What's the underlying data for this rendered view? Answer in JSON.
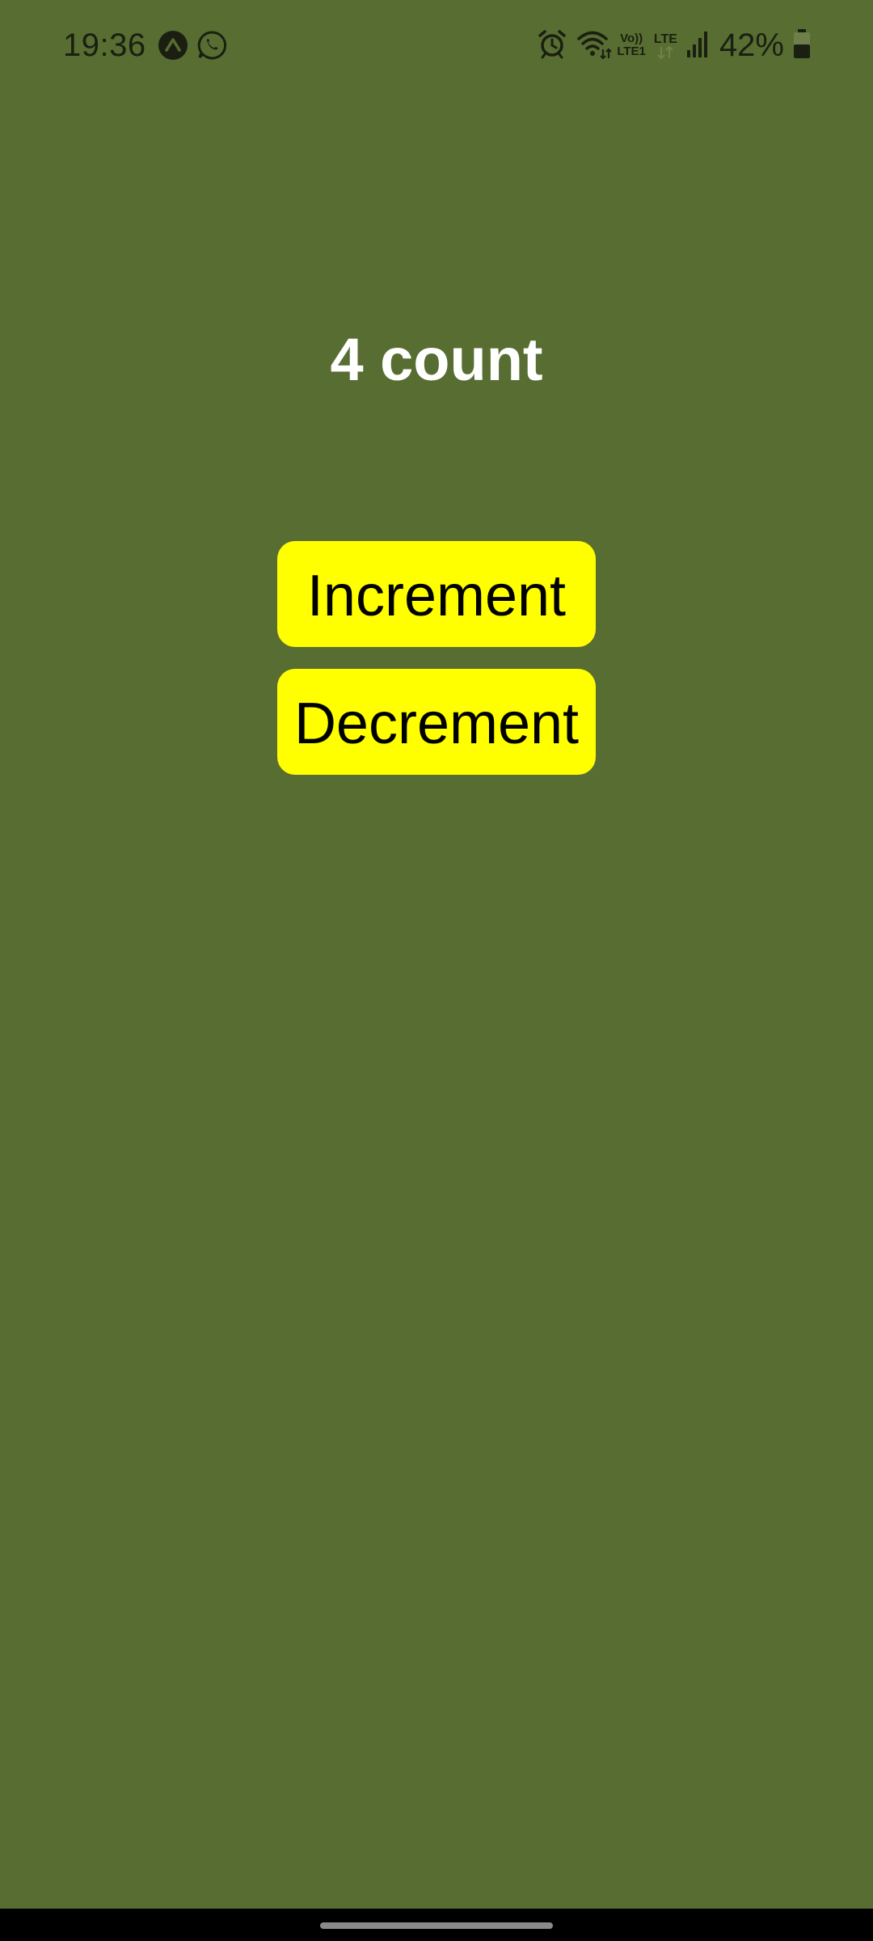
{
  "status_bar": {
    "time": "19:36",
    "notification_icons": [
      "expo-go-icon",
      "whatsapp-icon"
    ],
    "volte_top": "Vo))",
    "volte_bottom": "LTE1",
    "lte_label": "LTE",
    "battery_percent": "42%",
    "battery_level": 0.42
  },
  "main": {
    "count_text": "4 count",
    "increment_label": "Increment",
    "decrement_label": "Decrement"
  },
  "colors": {
    "background": "#586d31",
    "button": "#ffff00",
    "count_text": "#ffffff",
    "button_text": "#000000",
    "nav_bar": "#000000"
  }
}
